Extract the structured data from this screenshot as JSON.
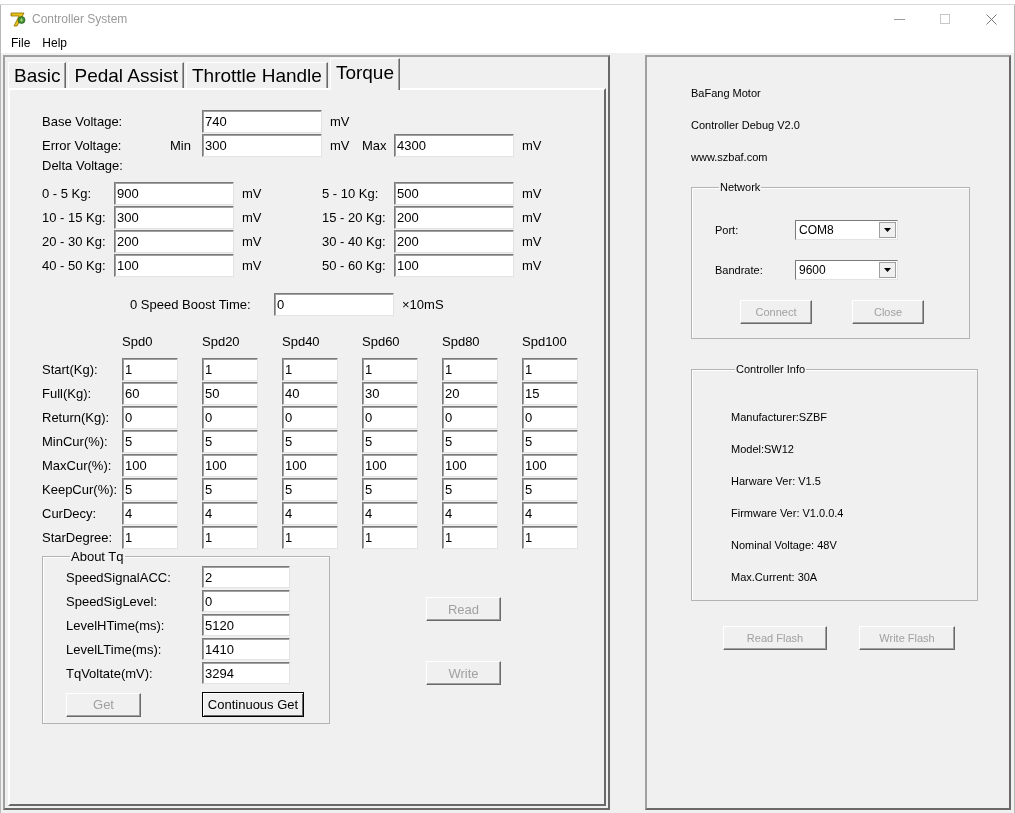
{
  "window": {
    "title": "Controller System"
  },
  "menu": [
    {
      "label": "File"
    },
    {
      "label": "Help"
    }
  ],
  "tabs": [
    {
      "label": "Basic",
      "selected": false
    },
    {
      "label": "Pedal Assist",
      "selected": false
    },
    {
      "label": "Throttle Handle",
      "selected": false
    },
    {
      "label": "Torque",
      "selected": true
    }
  ],
  "base_voltage": {
    "label": "Base Voltage:",
    "value": "740",
    "unit": "mV"
  },
  "error_voltage": {
    "label": "Error Voltage:",
    "min_label": "Min",
    "min_value": "300",
    "min_unit": "mV",
    "max_label": "Max",
    "max_value": "4300",
    "max_unit": "mV"
  },
  "delta_voltage": {
    "label": "Delta Voltage:",
    "items": [
      {
        "label": "0 - 5 Kg:",
        "value": "900",
        "unit": "mV"
      },
      {
        "label": "5 - 10 Kg:",
        "value": "500",
        "unit": "mV"
      },
      {
        "label": "10 - 15 Kg:",
        "value": "300",
        "unit": "mV"
      },
      {
        "label": "15 - 20 Kg:",
        "value": "200",
        "unit": "mV"
      },
      {
        "label": "20 - 30 Kg:",
        "value": "200",
        "unit": "mV"
      },
      {
        "label": "30 - 40 Kg:",
        "value": "200",
        "unit": "mV"
      },
      {
        "label": "40 - 50 Kg:",
        "value": "100",
        "unit": "mV"
      },
      {
        "label": "50 - 60 Kg:",
        "value": "100",
        "unit": "mV"
      }
    ]
  },
  "boost_time": {
    "label": "0 Speed Boost Time:",
    "value": "0",
    "unit": "×10mS"
  },
  "speed_table": {
    "columns": [
      "Spd0",
      "Spd20",
      "Spd40",
      "Spd60",
      "Spd80",
      "Spd100"
    ],
    "rows": [
      {
        "label": "Start(Kg):",
        "values": [
          "1",
          "1",
          "1",
          "1",
          "1",
          "1"
        ]
      },
      {
        "label": "Full(Kg):",
        "values": [
          "60",
          "50",
          "40",
          "30",
          "20",
          "15"
        ]
      },
      {
        "label": "Return(Kg):",
        "values": [
          "0",
          "0",
          "0",
          "0",
          "0",
          "0"
        ]
      },
      {
        "label": "MinCur(%):",
        "values": [
          "5",
          "5",
          "5",
          "5",
          "5",
          "5"
        ]
      },
      {
        "label": "MaxCur(%):",
        "values": [
          "100",
          "100",
          "100",
          "100",
          "100",
          "100"
        ]
      },
      {
        "label": "KeepCur(%):",
        "values": [
          "5",
          "5",
          "5",
          "5",
          "5",
          "5"
        ]
      },
      {
        "label": "CurDecy:",
        "values": [
          "4",
          "4",
          "4",
          "4",
          "4",
          "4"
        ]
      },
      {
        "label": "StarDegree:",
        "values": [
          "1",
          "1",
          "1",
          "1",
          "1",
          "1"
        ]
      }
    ]
  },
  "about_tq": {
    "title": "About Tq",
    "fields": [
      {
        "label": "SpeedSignalACC:",
        "value": "2"
      },
      {
        "label": "SpeedSigLevel:",
        "value": "0"
      },
      {
        "label": "LevelHTime(ms):",
        "value": "5120"
      },
      {
        "label": "LevelLTime(ms):",
        "value": "1410"
      },
      {
        "label": "TqVoltate(mV):",
        "value": "3294"
      }
    ],
    "buttons": [
      {
        "label": "Get",
        "disabled": true
      },
      {
        "label": "Continuous Get",
        "disabled": false
      }
    ]
  },
  "actions": [
    {
      "label": "Read",
      "disabled": true
    },
    {
      "label": "Write",
      "disabled": true
    }
  ],
  "about": [
    "BaFang Motor",
    "Controller Debug V2.0",
    "www.szbaf.com"
  ],
  "network": {
    "title": "Network",
    "fields": [
      {
        "label": "Port:",
        "value": "COM8"
      },
      {
        "label": "Bandrate:",
        "value": "9600"
      }
    ],
    "buttons": [
      {
        "label": "Connect",
        "disabled": true
      },
      {
        "label": "Close",
        "disabled": true
      }
    ]
  },
  "controller_info": {
    "title": "Controller Info",
    "lines": [
      "Manufacturer:SZBF",
      "Model:SW12",
      "Harware Ver: V1.5",
      "Firmware Ver: V1.0.0.4",
      "Nominal Voltage: 48V",
      "Max.Current: 30A"
    ]
  },
  "flash_buttons": [
    {
      "label": "Read Flash",
      "disabled": true
    },
    {
      "label": "Write Flash",
      "disabled": true
    }
  ]
}
